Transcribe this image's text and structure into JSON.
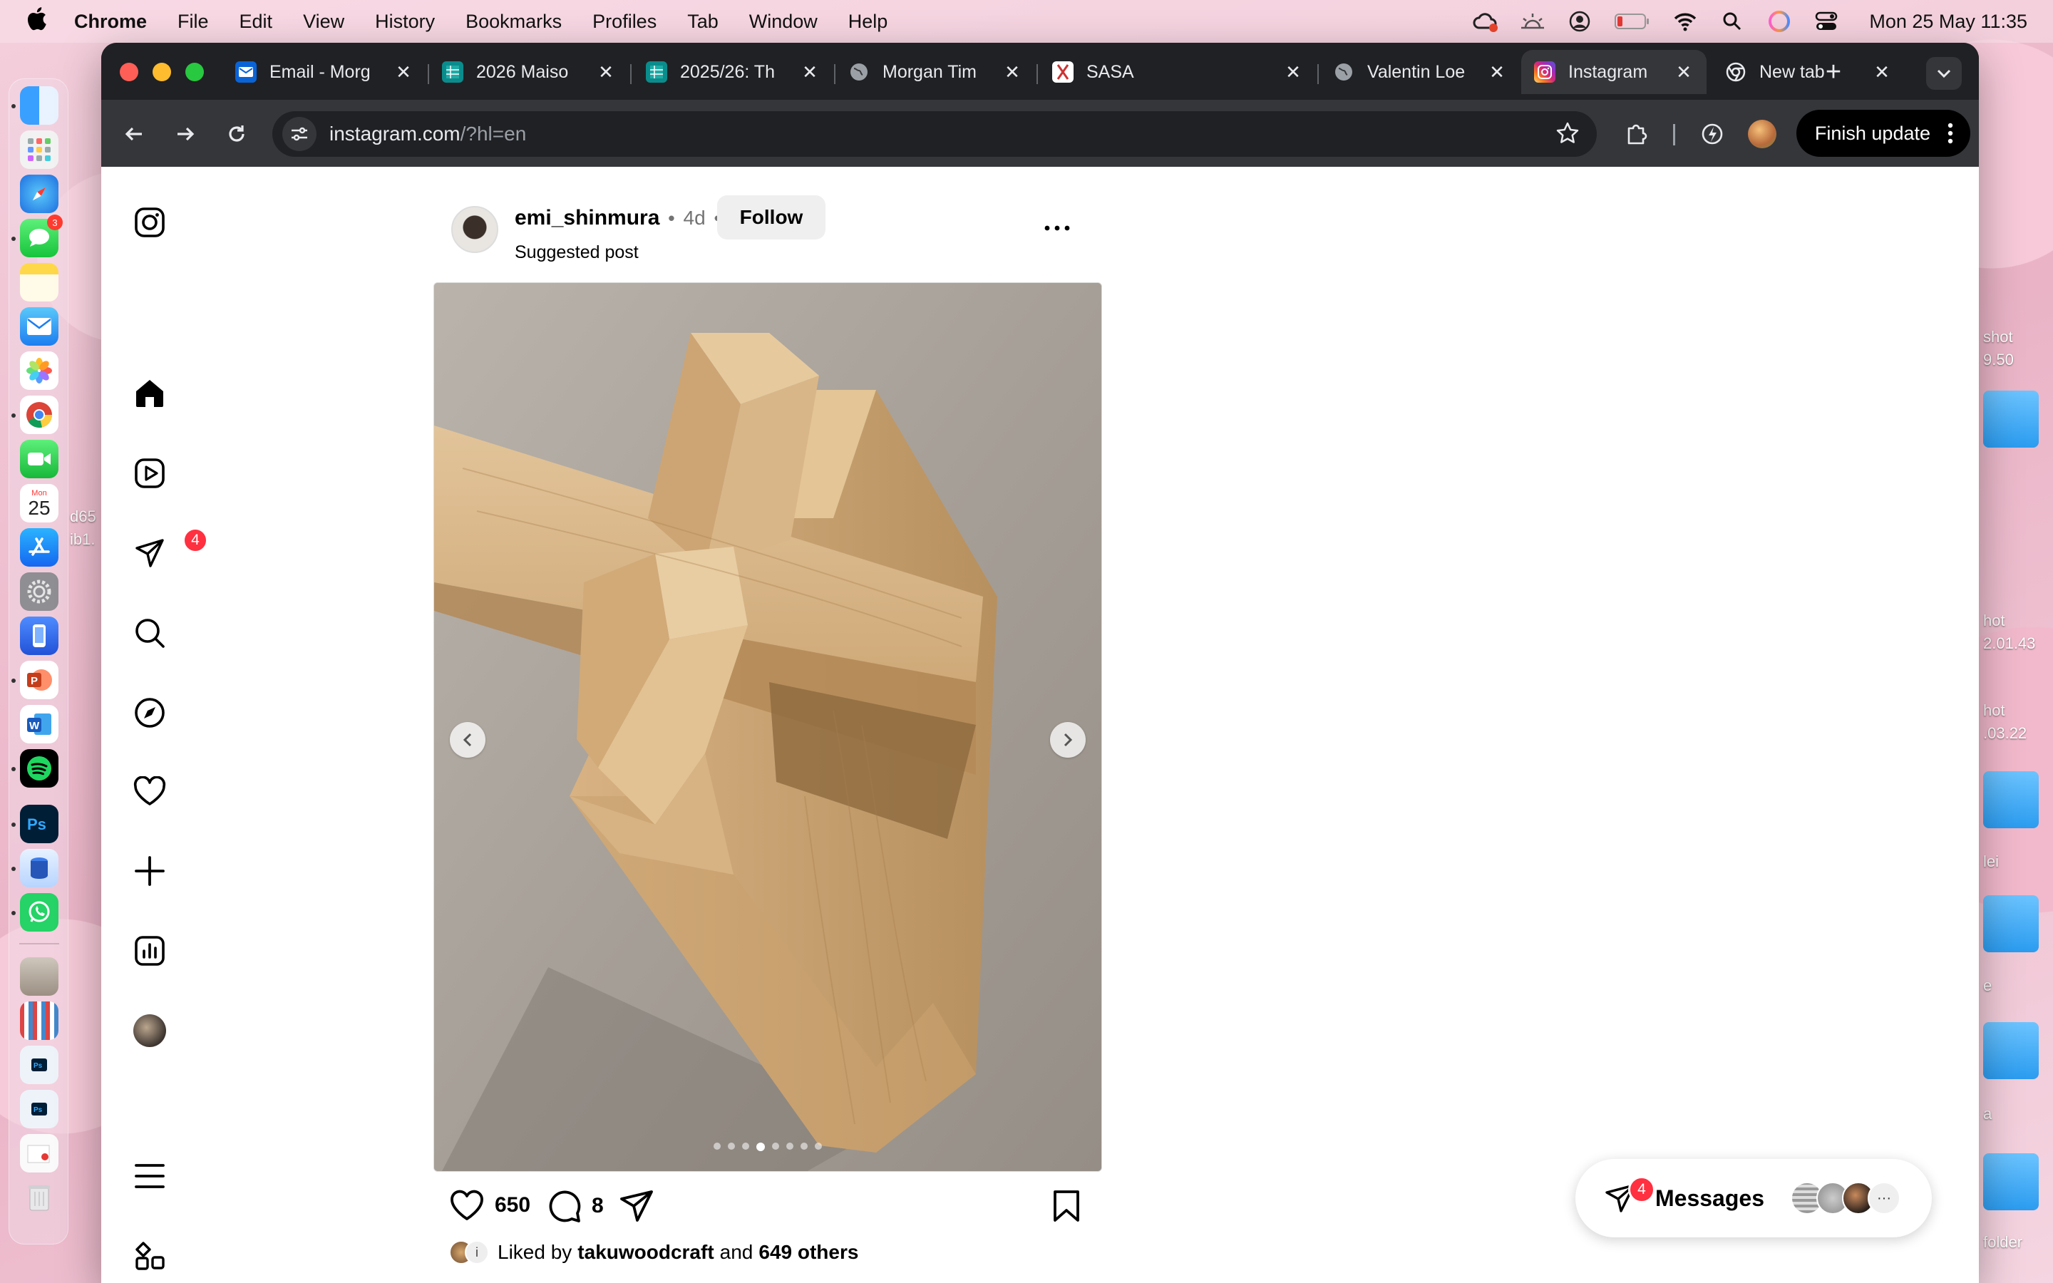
{
  "menubar": {
    "app": "Chrome",
    "items": [
      "File",
      "Edit",
      "View",
      "History",
      "Bookmarks",
      "Profiles",
      "Tab",
      "Window",
      "Help"
    ],
    "clock": "Mon 25 May  11:35"
  },
  "dock": {
    "messages_badge": "3",
    "calendar_day": "25",
    "calendar_month": "Mon"
  },
  "desktop": {
    "labels": [
      "shot",
      "9.50",
      "hot",
      "2.01.43",
      "hot",
      ".03.22",
      "lei",
      "e",
      "a",
      "folder",
      "d65",
      "ib1."
    ]
  },
  "browser": {
    "tabs": [
      {
        "title": "Email - Morg",
        "icon": "outlook-icon"
      },
      {
        "title": "2026 Maiso",
        "icon": "sheets-icon"
      },
      {
        "title": "2025/26: Th",
        "icon": "sheets-icon"
      },
      {
        "title": "Morgan Tim",
        "icon": "globe-icon"
      },
      {
        "title": "SASA",
        "icon": "sasa-icon"
      },
      {
        "title": "Valentin Loe",
        "icon": "globe-icon"
      },
      {
        "title": "Instagram",
        "icon": "instagram-icon",
        "active": true
      },
      {
        "title": "New tab",
        "icon": "chrome-icon"
      }
    ],
    "url_host": "instagram.com",
    "url_path": "/?hl=en",
    "finish_update": "Finish update"
  },
  "instagram": {
    "nav_badge": "4",
    "post": {
      "username": "emi_shinmura",
      "age": "4d",
      "follow_label": "Follow",
      "subtitle": "Suggested post",
      "carousel_total": 8,
      "carousel_index": 4,
      "likes_count": "650",
      "comments_count": "8",
      "liked_by_prefix": "Liked by",
      "liked_by_user": "takuwoodcraft",
      "liked_by_and": "and",
      "liked_by_others": "649 others"
    },
    "messages": {
      "label": "Messages",
      "badge": "4",
      "more": "···"
    }
  }
}
